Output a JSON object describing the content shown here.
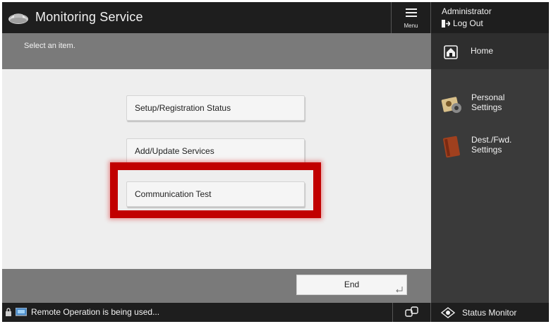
{
  "header": {
    "title": "Monitoring Service",
    "menu_label": "Menu",
    "user_name": "Administrator",
    "logout_label": "Log Out"
  },
  "main": {
    "instruction": "Select an item.",
    "items": [
      {
        "label": "Setup/Registration Status"
      },
      {
        "label": "Add/Update Services"
      },
      {
        "label": "Communication Test",
        "highlighted": true
      }
    ],
    "end_label": "End"
  },
  "right_panel": {
    "home_label": "Home",
    "shortcuts": [
      {
        "label": "Personal\nSettings",
        "icon": "personal-settings-icon"
      },
      {
        "label": "Dest./Fwd.\nSettings",
        "icon": "address-book-icon"
      }
    ]
  },
  "statusbar": {
    "message": "Remote Operation is being used...",
    "status_monitor_label": "Status Monitor"
  },
  "colors": {
    "highlight": "#c10000",
    "header_bg": "#1e1e1e",
    "subbar_bg": "#7a7a7a",
    "content_bg": "#eeeeee"
  }
}
